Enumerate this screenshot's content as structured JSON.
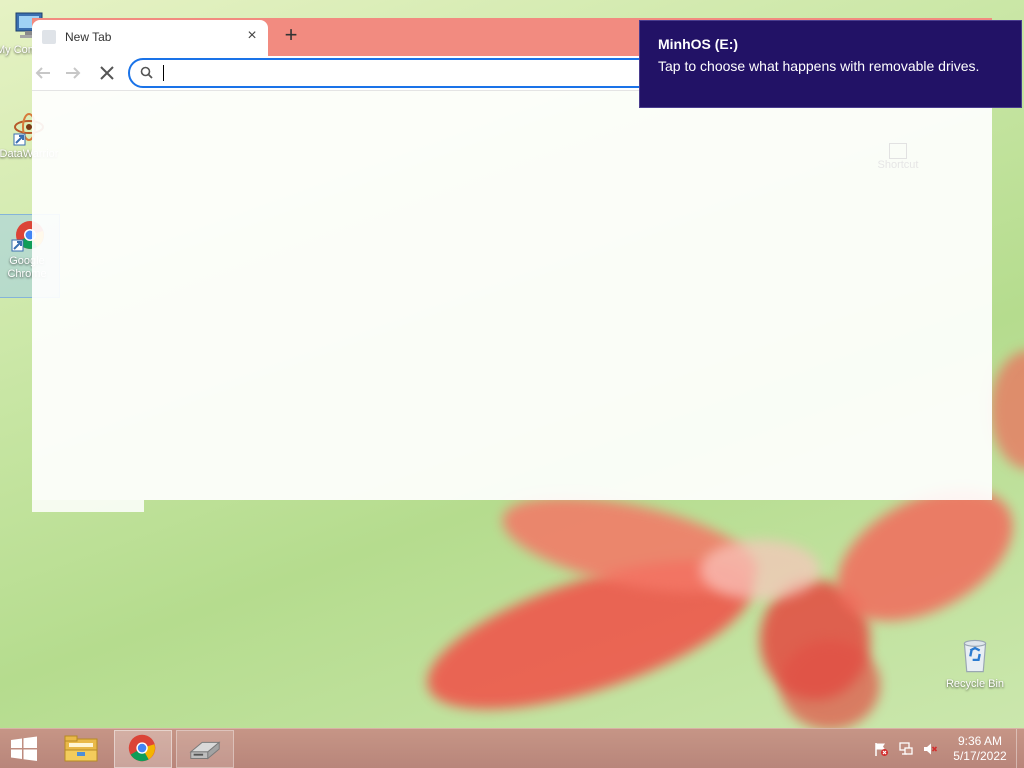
{
  "desktop": {
    "icons": [
      {
        "label": "My Computer",
        "icon": "computer-icon"
      },
      {
        "label": "DataWarrior",
        "icon": "datawarrior-icon"
      },
      {
        "label": "Google Chrome",
        "icon": "chrome-icon"
      },
      {
        "label": "Recycle Bin",
        "icon": "recycle-bin-icon"
      }
    ],
    "faded_shortcut_label": "Shortcut"
  },
  "browser": {
    "tab": {
      "title": "New Tab",
      "close_symbol": "×"
    },
    "new_tab_symbol": "+",
    "omnibox": {
      "value": "",
      "placeholder": ""
    },
    "tabstrip_color": "#f28b80"
  },
  "notification": {
    "title": "MinhOS (E:)",
    "body": "Tap to choose what happens with removable drives.",
    "background": "#221266"
  },
  "taskbar": {
    "pinned": [
      {
        "name": "file-explorer",
        "icon": "folder-icon"
      },
      {
        "name": "google-chrome",
        "icon": "chrome-icon",
        "active": true
      },
      {
        "name": "drive-app",
        "icon": "removable-drive-icon"
      }
    ],
    "tray": [
      "action-center-flag-icon",
      "network-icon",
      "volume-muted-icon"
    ],
    "clock": {
      "time": "9:36 AM",
      "date": "5/17/2022"
    }
  }
}
